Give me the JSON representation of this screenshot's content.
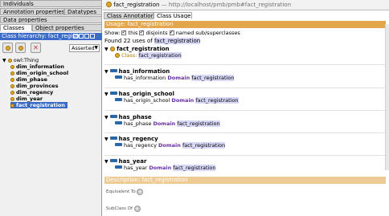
{
  "left": {
    "tabs_row1": [
      "Individuals"
    ],
    "tabs_row2": [
      "Annotation properties",
      "Datatypes"
    ],
    "tabs_row3": [
      "Data properties"
    ],
    "tabs_row4": [
      "Classes",
      "Object properties"
    ],
    "hierarchy_title": "Class hierarchy: fact_registr",
    "hierarchy_mode": "Asserted",
    "tree_root": "owl:Thing",
    "tree_items": [
      "dim_information",
      "dim_origin_school",
      "dim_phase",
      "dim_provinces",
      "dim_regency",
      "dim_year",
      "fact_registration"
    ]
  },
  "right": {
    "header_title": "fact_registration",
    "header_uri": " — http://localhost/pmb/pmb#fact_registration",
    "tabs": [
      "Class Annotations",
      "Class Usage"
    ],
    "usage_title": "Usage: fact_registration",
    "show_label": "Show:",
    "opt_this": "this",
    "opt_disjoints": "disjoints",
    "opt_named": "named sub/superclasses",
    "found_prefix": "Found 22 uses of ",
    "found_target": "fact_registration",
    "self_group": {
      "name": "fact_registration",
      "class_kw": "Class:",
      "class_val": "fact_registration"
    },
    "groups": [
      {
        "name": "has_information",
        "line_prop": "has_information",
        "line_kw": "Domain",
        "line_val": "fact_registration"
      },
      {
        "name": "has_origin_school",
        "line_prop": "has_origin_school",
        "line_kw": "Domain",
        "line_val": "fact_registration"
      },
      {
        "name": "has_phase",
        "line_prop": "has_phase",
        "line_kw": "Domain",
        "line_val": "fact_registration"
      },
      {
        "name": "has_regency",
        "line_prop": "has_regency",
        "line_kw": "Domain",
        "line_val": "fact_registration"
      },
      {
        "name": "has_year",
        "line_prop": "has_year",
        "line_kw": "Domain",
        "line_val": "fact_registration"
      }
    ],
    "description_title": "Description: fact_registration",
    "equivalent_to": "Equivalent To",
    "subclass_of": "SubClass Of"
  },
  "colors": {
    "accent": "#3b6bc9",
    "section": "#e3a64d",
    "class_dot": "#e0a826",
    "property": "#2a67a8",
    "keyword": "#6a2ea7"
  }
}
